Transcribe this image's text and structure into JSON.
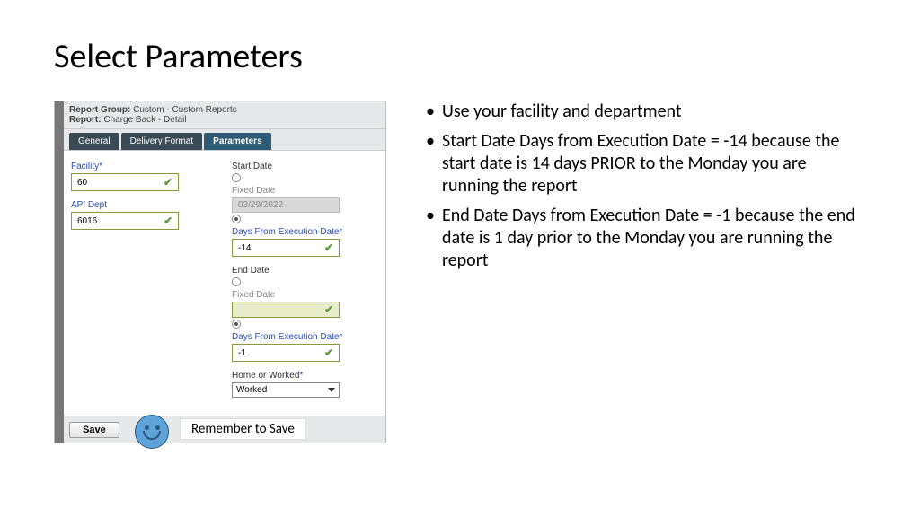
{
  "title": "Select Parameters",
  "header": {
    "report_group_label": "Report Group:",
    "report_group_value": "Custom - Custom Reports",
    "report_label": "Report:",
    "report_value": "Charge Back - Detail"
  },
  "tabs": {
    "general": "General",
    "delivery": "Delivery Format",
    "parameters": "Parameters"
  },
  "left_fields": {
    "facility_label": "Facility",
    "facility_value": "60",
    "api_dept_label": "API Dept",
    "api_dept_value": "6016"
  },
  "right_fields": {
    "start_date_label": "Start Date",
    "fixed_date_label": "Fixed Date",
    "fixed_date_value": "03/29/2022",
    "days_from_exec_label": "Days From Execution Date",
    "days_from_exec_start": "-14",
    "end_date_label": "End Date",
    "days_from_exec_end": "-1",
    "home_worked_label": "Home or Worked",
    "home_worked_value": "Worked"
  },
  "save_label": "Save",
  "remember_label": "Remember to Save",
  "bullets": {
    "b1": "Use your facility and department",
    "b2": "Start Date Days from Execution Date = -14 because the start date is 14 days PRIOR to the Monday you are running the report",
    "b3": "End Date Days from Execution Date = -1 because the end date is 1 day prior to the Monday you are running the report"
  }
}
